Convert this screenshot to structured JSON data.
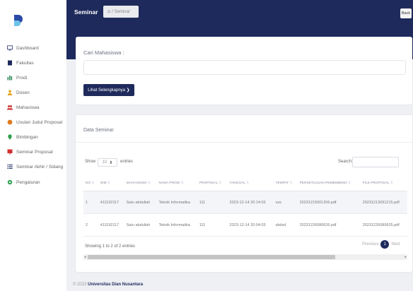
{
  "sidebar": {
    "items": [
      {
        "label": "Dashboard",
        "icon": "monitor-icon"
      },
      {
        "label": "Fakultas",
        "icon": "building-icon"
      },
      {
        "label": "Prodi",
        "icon": "chart-icon"
      },
      {
        "label": "Dosen",
        "icon": "user-icon"
      },
      {
        "label": "Mahasiswa",
        "icon": "users-icon"
      },
      {
        "label": "Usulan Judul Proposal",
        "icon": "paper-plane-icon"
      },
      {
        "label": "Bimbingan",
        "icon": "location-pin-icon"
      },
      {
        "label": "Seminar Proposal",
        "icon": "presentation-icon"
      },
      {
        "label": "Seminar Akhir / Sidang",
        "icon": "list-icon"
      },
      {
        "label": "Pengaturan",
        "icon": "gear-icon"
      }
    ]
  },
  "header": {
    "title": "Seminar",
    "breadcrumb": "/ Seminar",
    "back_label": "Back"
  },
  "search_card": {
    "label": "Cari Mahasiswa :",
    "input_value": "",
    "button_label": "Lihat Selengkapnya ❯"
  },
  "data_card": {
    "title": "Data Seminar",
    "show_label": "Show",
    "entries_value": "10",
    "entries_label": "entries",
    "search_label": "Search:",
    "columns": [
      "NO",
      "NIM",
      "MAHASISWA",
      "NAMA PRODI",
      "PROPOSAL",
      "TANGGAL",
      "TEMPAT",
      "PERSETUJUAN PEMBIMBING",
      "FILE PROPOSAL"
    ],
    "rows": [
      [
        "1",
        "411192117",
        "Satu abdullah",
        "Teknik Informatika",
        "111",
        "2023-12-14 20:14:03",
        "sss",
        "20231215001206.pdf",
        "20231213091215.pdf"
      ],
      [
        "2",
        "411192117",
        "Satu abdullah",
        "Teknik Informatika",
        "111",
        "2023-12-14 20:04:03",
        "sbdsd",
        "20231226080626.pdf",
        "20231226080625.pdf"
      ]
    ],
    "info": "Showing 1 to 2 of 2 entries",
    "prev_label": "Previous",
    "page_current": "1",
    "next_label": "Next"
  },
  "footer": {
    "copyright": "© 2023",
    "org": "Universitas Dian Nusantara"
  },
  "colors": {
    "primary": "#1f2a5c",
    "background": "#eef0f4",
    "card": "#ffffff"
  }
}
